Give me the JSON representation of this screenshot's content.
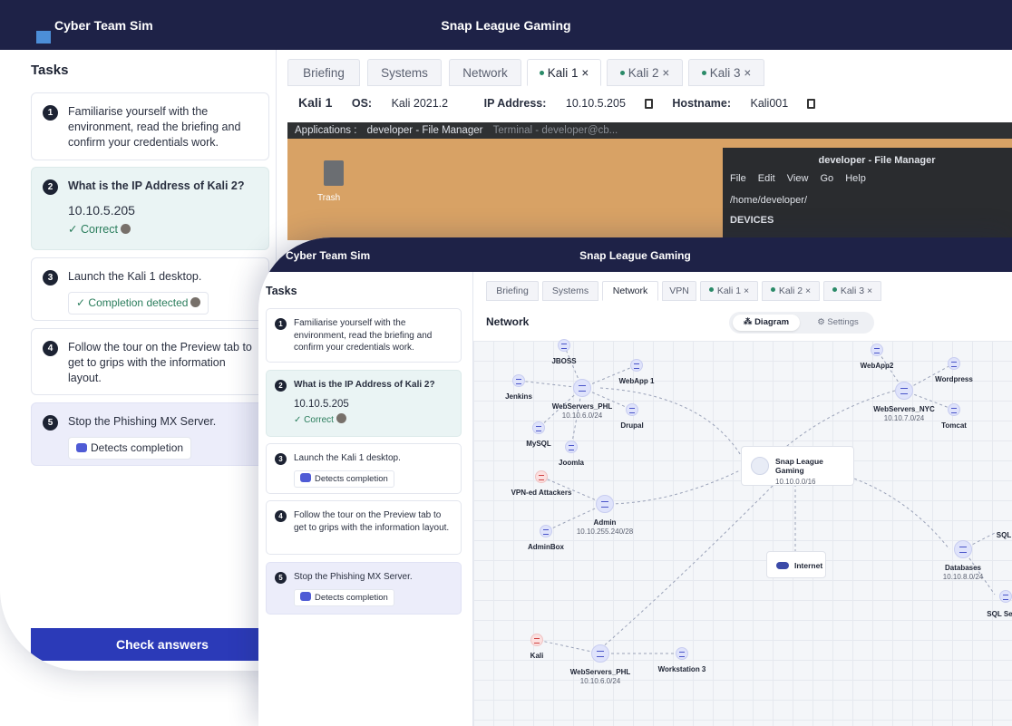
{
  "back": {
    "app_name": "Cyber Team Sim",
    "window_title": "Snap League Gaming",
    "tasks_heading": "Tasks",
    "tasks": [
      {
        "num": "1",
        "text": "Familiarise yourself with the environment, read the briefing and confirm your credentials work."
      },
      {
        "num": "2",
        "question": "What is the IP Address of Kali 2?",
        "answer": "10.10.5.205",
        "status": "Correct"
      },
      {
        "num": "3",
        "text": "Launch the Kali 1 desktop.",
        "status": "Completion detected"
      },
      {
        "num": "4",
        "text": "Follow the tour on the Preview tab to get to grips with the information layout."
      },
      {
        "num": "5",
        "text": "Stop the Phishing MX Server.",
        "status": "Detects completion"
      }
    ],
    "check_button": "Check answers",
    "tabs": [
      "Briefing",
      "Systems",
      "Network",
      "Kali 1 ×",
      "Kali 2 ×",
      "Kali 3 ×"
    ],
    "info": {
      "host": "Kali 1",
      "os_label": "OS:",
      "os_value": "Kali 2021.2",
      "ip_label": "IP Address:",
      "ip_value": "10.10.5.205",
      "hostname_label": "Hostname:",
      "hostname_value": "Kali001"
    },
    "desktop": {
      "taskbar": [
        "Applications :",
        "developer - File Manager",
        "Terminal - developer@cb..."
      ],
      "trash_label": "Trash",
      "fm_title": "developer - File Manager",
      "fm_menu": "File Edit View Go Help",
      "fm_path": "/home/developer/",
      "fm_devices": "DEVICES"
    }
  },
  "front": {
    "app_name": "Cyber Team Sim",
    "window_title": "Snap League Gaming",
    "tasks_heading": "Tasks",
    "tasks": [
      {
        "num": "1",
        "text": "Familiarise yourself with the environment, read the briefing and confirm your credentials work."
      },
      {
        "num": "2",
        "question": "What is the IP Address of Kali 2?",
        "answer": "10.10.5.205",
        "status": "Correct"
      },
      {
        "num": "3",
        "text": "Launch the Kali 1 desktop.",
        "status": "Detects completion"
      },
      {
        "num": "4",
        "text": "Follow the tour on the Preview tab to get to grips with the information layout."
      },
      {
        "num": "5",
        "text": "Stop the Phishing MX Server.",
        "status": "Detects completion"
      }
    ],
    "tabs": [
      "Briefing",
      "Systems",
      "Network",
      "VPN",
      "Kali 1 ×",
      "Kali 2 ×",
      "Kali 3 ×"
    ],
    "network_heading": "Network",
    "toggle_diagram": "Diagram",
    "toggle_settings": "Settings",
    "nodes": {
      "jboss": "JBOSS",
      "webapp1": "WebApp 1",
      "jenkins": "Jenkins",
      "webservers_phl": "WebServers_PHL",
      "webservers_phl_ip": "10.10.6.0/24",
      "mysql": "MySQL",
      "drupal": "Drupal",
      "joomla": "Joomla",
      "webapp2": "WebApp2",
      "wordpress": "Wordpress",
      "webservers_nyc": "WebServers_NYC",
      "webservers_nyc_ip": "10.10.7.0/24",
      "tomcat": "Tomcat",
      "snap": "Snap League Gaming",
      "snap_ip": "10.10.0.0/16",
      "vpn_attackers": "VPN-ed Attackers",
      "admin": "Admin",
      "admin_ip": "10.10.255.240/28",
      "adminbox": "AdminBox",
      "internet": "Internet",
      "databases": "Databases",
      "databases_ip": "10.10.8.0/24",
      "sql": "SQL",
      "sql_server": "SQL Ser",
      "kali": "Kali",
      "webservers_phl2": "WebServers_PHL",
      "webservers_phl2_ip": "10.10.6.0/24",
      "workstation3": "Workstation 3"
    }
  }
}
